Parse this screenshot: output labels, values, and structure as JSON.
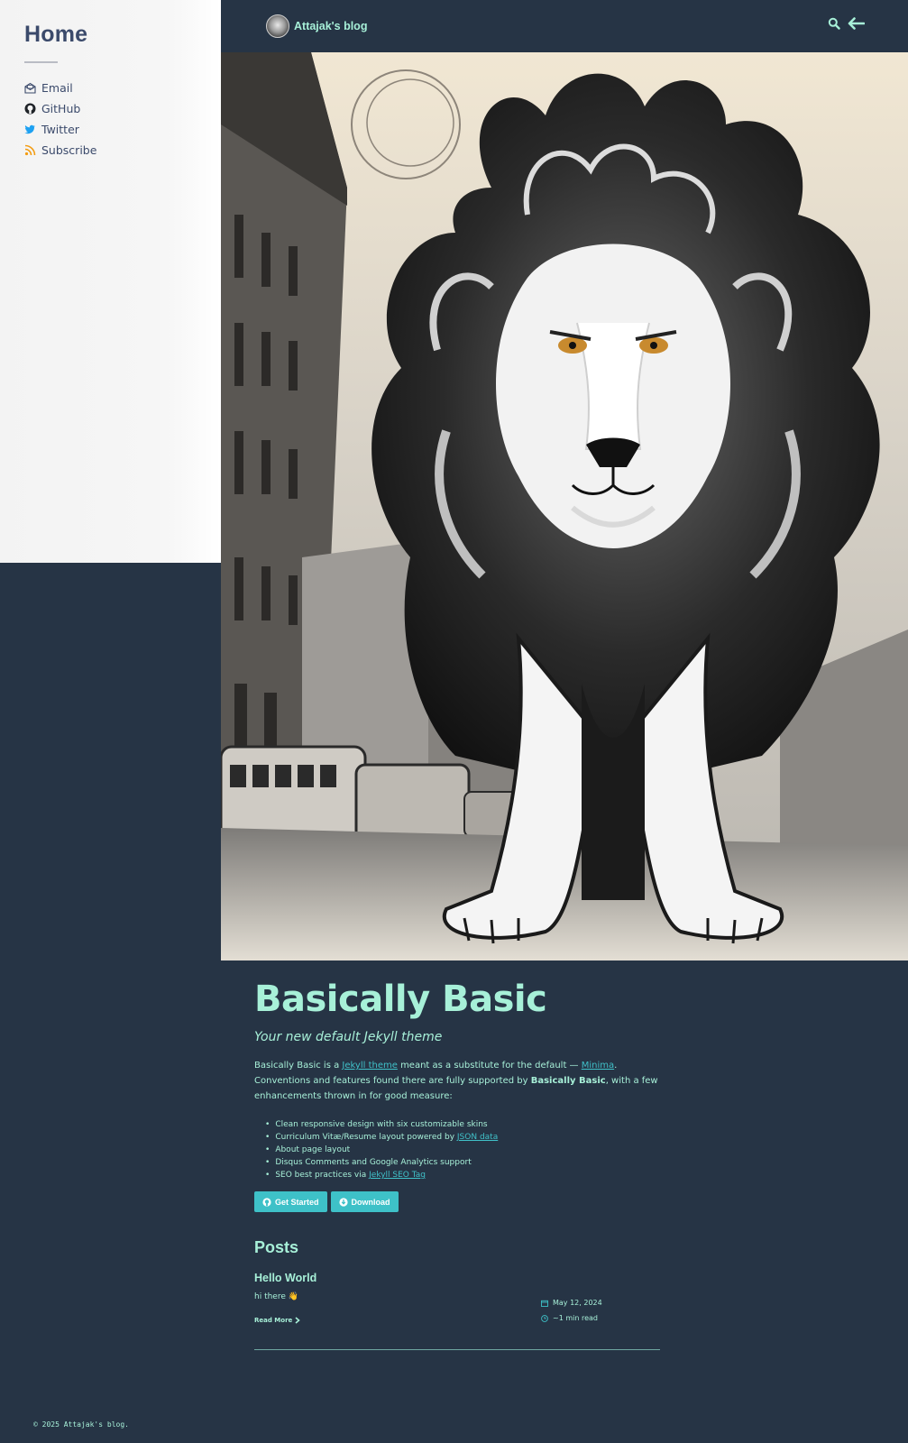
{
  "sidebar": {
    "title": "Home",
    "links": [
      {
        "label": "Email",
        "icon": "email-icon"
      },
      {
        "label": "GitHub",
        "icon": "github-icon"
      },
      {
        "label": "Twitter",
        "icon": "twitter-icon"
      },
      {
        "label": "Subscribe",
        "icon": "rss-icon"
      }
    ]
  },
  "header": {
    "site_title": "Attajak's blog",
    "actions": [
      "search-icon",
      "arrow-left-icon"
    ]
  },
  "hero": {
    "image": "lion-illustration"
  },
  "main": {
    "title": "Basically Basic",
    "subtitle": "Your new default Jekyll theme",
    "intro": {
      "part1": "Basically Basic is a ",
      "link1": "Jekyll theme",
      "part2": " meant as a substitute for the default — ",
      "link2": "Minima",
      "part3": ". Conventions and features found there are fully supported by ",
      "bold": "Basically Basic",
      "part4": ", with a few enhancements thrown in for good measure:"
    },
    "features": [
      {
        "text": "Clean responsive design with six customizable skins",
        "link": ""
      },
      {
        "text": "Curriculum Vitæ/Resume layout powered by ",
        "link": "JSON data"
      },
      {
        "text": "About page layout",
        "link": ""
      },
      {
        "text": "Disqus Comments and Google Analytics support",
        "link": ""
      },
      {
        "text": "SEO best practices via ",
        "link": "Jekyll SEO Tag"
      }
    ],
    "buttons": {
      "get_started": "Get Started",
      "download": "Download"
    },
    "posts_heading": "Posts",
    "posts": [
      {
        "title": "Hello World",
        "excerpt": "hi there 👋",
        "read_more": "Read More",
        "date": "May 12, 2024",
        "read_time": "~1 min read"
      }
    ]
  },
  "footer": {
    "text": "© 2025 Attajak's blog."
  },
  "colors": {
    "background": "#263445",
    "accent_text": "#a7f0d8",
    "link": "#40c1c9",
    "button": "#3ec1c8",
    "sidebar_bg": "#f4f4f4",
    "sidebar_text": "#3b4a6b"
  }
}
